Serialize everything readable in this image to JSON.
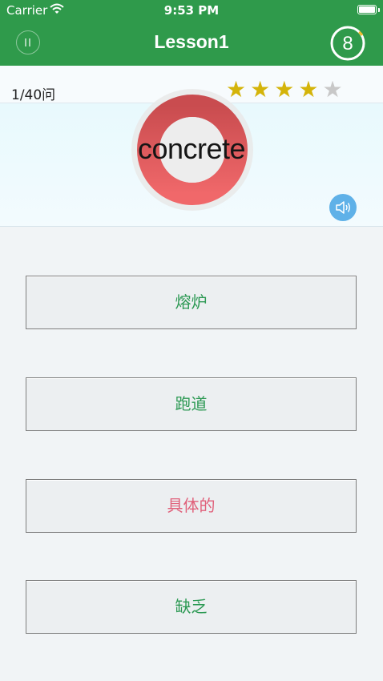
{
  "status_bar": {
    "carrier": "Carrier",
    "time": "9:53 PM"
  },
  "nav": {
    "title": "Lesson1",
    "timer": "8"
  },
  "progress": {
    "text": "1/40问",
    "rating": 4,
    "max_rating": 5
  },
  "word": {
    "text": "concrete",
    "ring_color": "#e8585c"
  },
  "answers": [
    {
      "label": "熔炉"
    },
    {
      "label": "跑道"
    },
    {
      "label": "具体的"
    },
    {
      "label": "缺乏"
    }
  ],
  "colors": {
    "header": "#2f9a4b",
    "answer_text": "#2e9a55",
    "answer_highlight": "#e0607a",
    "star": "#d4b40a",
    "speaker": "#5fb1e8"
  },
  "icons": {
    "pause": "pause-icon",
    "speaker": "speaker-icon",
    "wifi": "wifi-icon",
    "battery": "battery-icon"
  }
}
